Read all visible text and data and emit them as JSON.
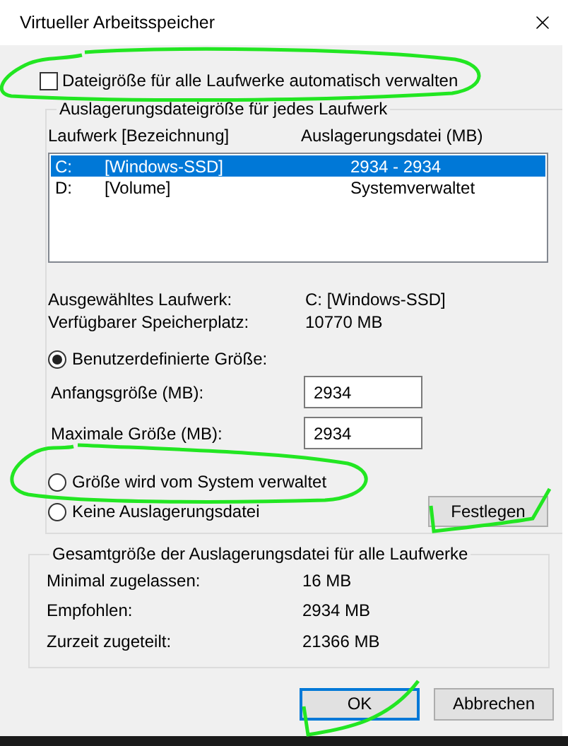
{
  "window": {
    "title": "Virtueller Arbeitsspeicher"
  },
  "auto_manage": {
    "label": "Dateigröße für alle Laufwerke automatisch verwalten",
    "checked": false
  },
  "drive_group": {
    "legend": "Auslagerungsdateigröße für jedes Laufwerk",
    "columns": [
      "Laufwerk [Bezeichnung]",
      "Auslagerungsdatei (MB)"
    ],
    "drives": [
      {
        "drive": "C:",
        "label": "[Windows-SSD]",
        "paging_file": "2934 - 2934",
        "selected": true
      },
      {
        "drive": "D:",
        "label": "[Volume]",
        "paging_file": "Systemverwaltet",
        "selected": false
      }
    ],
    "info": [
      {
        "label": "Ausgewähltes Laufwerk:",
        "value": "C:  [Windows-SSD]"
      },
      {
        "label": "Verfügbarer Speicherplatz:",
        "value": "10770 MB"
      }
    ],
    "size_options": [
      {
        "label": "Benutzerdefinierte Größe:",
        "selected": true,
        "fields": [
          {
            "label": "Anfangsgröße (MB):",
            "value": "2934"
          },
          {
            "label": "Maximale Größe (MB):",
            "value": "2934"
          }
        ]
      },
      {
        "label": "Größe wird vom System verwaltet",
        "selected": false
      },
      {
        "label": "Keine Auslagerungsdatei",
        "selected": false
      }
    ],
    "set_button": "Festlegen"
  },
  "total_group": {
    "legend": "Gesamtgröße der Auslagerungsdatei für alle Laufwerke",
    "rows": [
      {
        "label": "Minimal zugelassen:",
        "value": "16 MB"
      },
      {
        "label": "Empfohlen:",
        "value": "2934 MB"
      },
      {
        "label": "Zurzeit zugeteilt:",
        "value": "21366 MB"
      }
    ]
  },
  "buttons": [
    {
      "label": "OK",
      "default": true
    },
    {
      "label": "Abbrechen",
      "default": false
    }
  ]
}
